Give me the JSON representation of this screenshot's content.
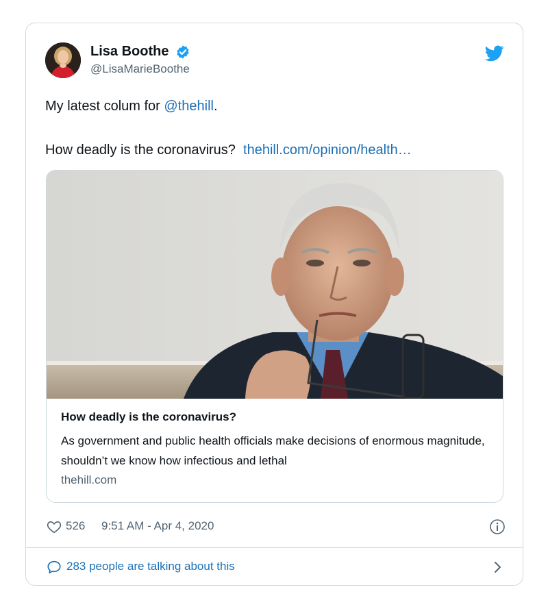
{
  "author": {
    "display_name": "Lisa Boothe",
    "handle": "@LisaMarieBoothe",
    "verified": true
  },
  "tweet": {
    "line1_prefix": "My latest colum for ",
    "line1_mention": "@thehill",
    "line1_suffix": ".",
    "line2_text": "How deadly is the coronavirus?",
    "line2_link": "thehill.com/opinion/health…"
  },
  "card": {
    "title": "How deadly is the coronavirus?",
    "description": "As government and public health officials make decisions of enormous magnitude, shouldn’t we know how infectious and lethal",
    "domain": "thehill.com"
  },
  "meta": {
    "likes": "526",
    "timestamp": "9:51 AM - Apr 4, 2020"
  },
  "footer": {
    "talking": "283 people are talking about this"
  },
  "icons": {
    "verified": "verified-badge-icon",
    "bird": "twitter-bird-icon",
    "heart": "heart-icon",
    "info": "info-icon",
    "bubble": "speech-bubble-icon",
    "chevron": "chevron-right-icon"
  },
  "colors": {
    "link": "#1b6fb5",
    "twitter_blue": "#1da1f2",
    "muted": "#536471",
    "border": "#cfd9de"
  }
}
